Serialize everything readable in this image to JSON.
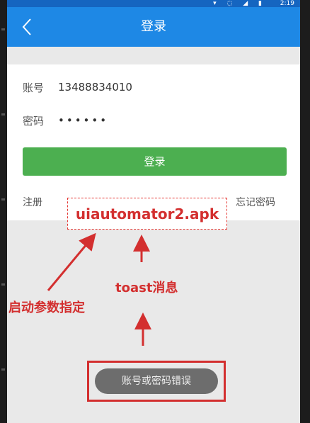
{
  "status_bar": {
    "time": "2:19"
  },
  "app_bar": {
    "title": "登录"
  },
  "form": {
    "account_label": "账号",
    "account_value": "13488834010",
    "password_label": "密码",
    "password_value": "••••••",
    "login_button": "登录",
    "register_link": "注册",
    "forgot_link": "忘记密码"
  },
  "annotations": {
    "apk_label": "uiautomator2.apk",
    "toast_label": "toast消息",
    "param_label": "启动参数指定"
  },
  "toast": {
    "message": "账号或密码错误"
  },
  "colors": {
    "app_bar": "#1e88e5",
    "login_button": "#4caf50",
    "annotation": "#d32f2f",
    "toast": "#6d6d6d"
  },
  "icons": [
    "chevron-left-icon",
    "wifi-icon",
    "signal-icon",
    "battery-icon"
  ]
}
